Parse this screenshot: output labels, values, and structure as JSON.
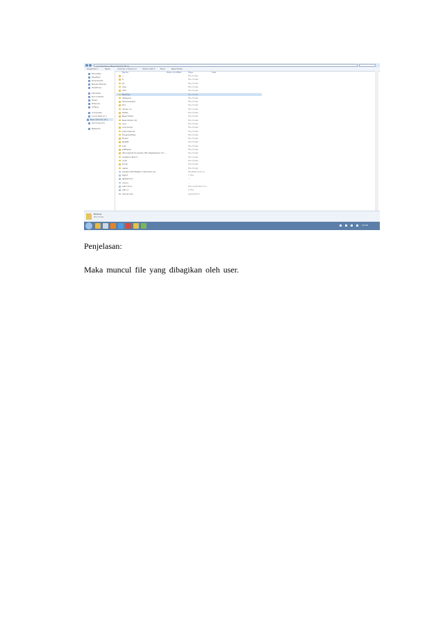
{
  "screenshot": {
    "address_text": "▸ Computer ▸ New Volume (E:) ▸",
    "toolbar": [
      "Organize ▾",
      "Open",
      "Include in library ▾",
      "Share with ▾",
      "Burn",
      "New folder"
    ],
    "sidebar": [
      {
        "label": "Favorites",
        "icon": "star-icon"
      },
      {
        "label": "Desktop",
        "icon": "desktop-icon"
      },
      {
        "label": "Downloads",
        "icon": "download-icon"
      },
      {
        "label": "Recent Places",
        "icon": "recent-icon"
      },
      {
        "label": "OneDrive",
        "icon": "cloud-icon"
      },
      {
        "label": "Libraries",
        "icon": "library-icon"
      },
      {
        "label": "Documents",
        "icon": "document-icon"
      },
      {
        "label": "Music",
        "icon": "music-icon"
      },
      {
        "label": "Pictures",
        "icon": "picture-icon"
      },
      {
        "label": "Videos",
        "icon": "video-icon"
      },
      {
        "label": "Computer",
        "icon": "computer-icon"
      },
      {
        "label": "Local Disk (C:)",
        "icon": "drive-icon"
      },
      {
        "label": "New Volume (E:)",
        "icon": "drive-icon"
      },
      {
        "label": "CD Drive (F:)",
        "icon": "cd-icon"
      },
      {
        "label": "Network",
        "icon": "network-icon"
      }
    ],
    "columns": [
      "Name",
      "Date modified",
      "Type",
      "Size"
    ],
    "rows": [
      {
        "name": "...",
        "date": "",
        "type": "File folder",
        "size": ""
      },
      {
        "name": "b",
        "date": "",
        "type": "File folder",
        "size": ""
      },
      {
        "name": "bt",
        "date": "",
        "type": "File folder",
        "size": ""
      },
      {
        "name": "ade",
        "date": "",
        "type": "File folder",
        "size": ""
      },
      {
        "name": "afm",
        "date": "",
        "type": "File folder",
        "size": ""
      },
      {
        "name": "BackUp",
        "date": "",
        "type": "File folder",
        "size": ""
      },
      {
        "name": "dbasene",
        "date": "",
        "type": "File folder",
        "size": ""
      },
      {
        "name": "Downloaded",
        "date": "",
        "type": "File folder",
        "size": ""
      },
      {
        "name": "Drv",
        "date": "",
        "type": "File folder",
        "size": ""
      },
      {
        "name": "driver nu",
        "date": "",
        "type": "File folder",
        "size": ""
      },
      {
        "name": "HASIL",
        "date": "",
        "type": "File folder",
        "size": ""
      },
      {
        "name": "New folder",
        "date": "",
        "type": "File folder",
        "size": ""
      },
      {
        "name": "New folder (2)",
        "date": "",
        "type": "File folder",
        "size": ""
      },
      {
        "name": "nau",
        "date": "",
        "type": "File folder",
        "size": ""
      },
      {
        "name": "nuk pump",
        "date": "",
        "type": "File folder",
        "size": ""
      },
      {
        "name": "pak internet",
        "date": "",
        "type": "File folder",
        "size": ""
      },
      {
        "name": "ProgramFiles",
        "date": "",
        "type": "File folder",
        "size": ""
      },
      {
        "name": "Runtu",
        "date": "",
        "type": "File folder",
        "size": ""
      },
      {
        "name": "Ryzatt",
        "date": "",
        "type": "File folder",
        "size": ""
      },
      {
        "name": "sub",
        "date": "",
        "type": "File folder",
        "size": ""
      },
      {
        "name": "software",
        "date": "",
        "type": "File folder",
        "size": ""
      },
      {
        "name": "Stronghold Crusader HD (September 27,...",
        "date": "",
        "type": "File folder",
        "size": ""
      },
      {
        "name": "Sublime Text 3",
        "date": "",
        "type": "File folder",
        "size": ""
      },
      {
        "name": "uni2",
        "date": "",
        "type": "File folder",
        "size": ""
      },
      {
        "name": "tump",
        "date": "",
        "type": "File folder",
        "size": ""
      },
      {
        "name": "uwop",
        "date": "",
        "type": "File folder",
        "size": ""
      },
      {
        "name": "Adobe CS6 Master Collection.rar",
        "date": "",
        "type": "WinRAR archive",
        "size": ""
      },
      {
        "name": "bgit.t",
        "date": "",
        "type": "T File",
        "size": ""
      },
      {
        "name": "gpwersion",
        "date": "",
        "type": "...",
        "size": ""
      },
      {
        "name": "menu",
        "date": "",
        "type": "...",
        "size": ""
      },
      {
        "name": "sam.docx",
        "date": "",
        "type": "Microsoft Word D...",
        "size": ""
      },
      {
        "name": "setu.x",
        "date": "",
        "type": "X File",
        "size": ""
      },
      {
        "name": "winrar.exe",
        "date": "",
        "type": "Application",
        "size": ""
      }
    ],
    "selected_row": 5,
    "details": {
      "name": "BackUp",
      "type": "File folder"
    },
    "clock": "10:08"
  },
  "caption": "Penjelasan:",
  "body": "Maka muncul file yang dibagikan oleh user."
}
